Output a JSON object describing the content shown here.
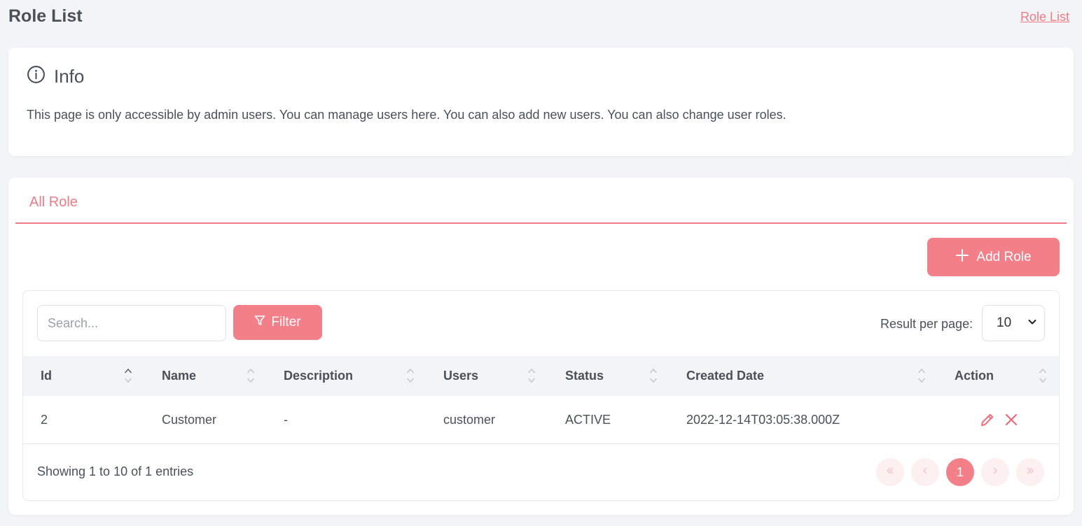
{
  "header": {
    "title": "Role List",
    "breadcrumb": "Role List"
  },
  "info": {
    "title": "Info",
    "text": "This page is only accessible by admin users. You can manage users here. You can also add new users. You can also change user roles."
  },
  "tabs": [
    {
      "label": "All Role",
      "active": true
    }
  ],
  "toolbar": {
    "add_label": "Add Role",
    "search_placeholder": "Search...",
    "filter_label": "Filter",
    "rpp_label": "Result per page:",
    "rpp_value": "10"
  },
  "table": {
    "columns": [
      "Id",
      "Name",
      "Description",
      "Users",
      "Status",
      "Created Date",
      "Action"
    ],
    "rows": [
      {
        "id": "2",
        "name": "Customer",
        "description": "-",
        "users": "customer",
        "status": "ACTIVE",
        "created": "2022-12-14T03:05:38.000Z"
      }
    ]
  },
  "footer": {
    "showing": "Showing 1 to 10 of 1 entries",
    "current_page": "1"
  },
  "colors": {
    "accent": "#f37f89",
    "text": "#4b5058",
    "background": "#f3f4f6"
  },
  "icons": [
    "info-icon",
    "plus-icon",
    "filter-icon",
    "sort-icon",
    "edit-icon",
    "delete-icon",
    "chevron-down-icon"
  ]
}
